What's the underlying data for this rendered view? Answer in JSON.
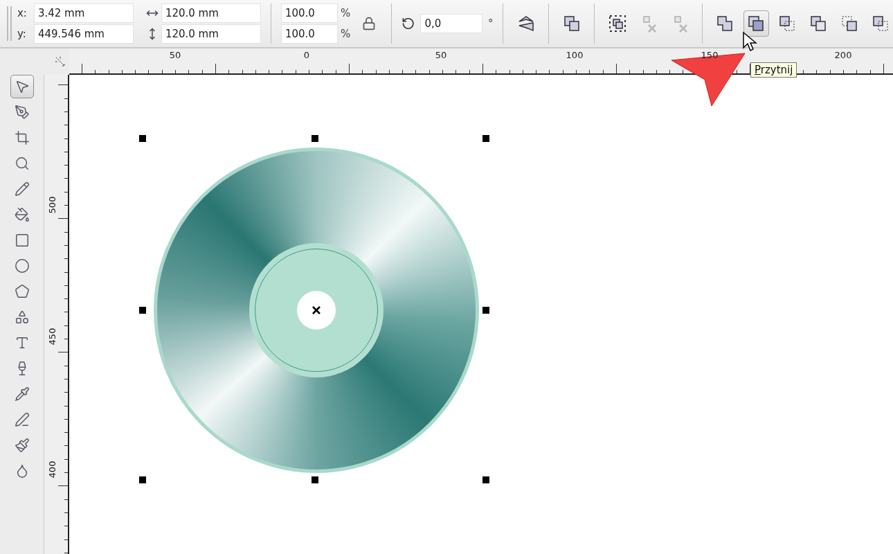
{
  "property_bar": {
    "position": [
      {
        "label": "x:",
        "value": "3.42 mm"
      },
      {
        "label": "y:",
        "value": "449.546 mm"
      }
    ],
    "size": [
      {
        "value": "120.0 mm"
      },
      {
        "value": "120.0 mm"
      }
    ],
    "scale": [
      {
        "value": "100.0",
        "unit": "%"
      },
      {
        "value": "100.0",
        "unit": "%"
      }
    ],
    "lock_ratio": {
      "on": false
    },
    "rotation": {
      "value": "0,0",
      "unit": "°"
    },
    "buttons": [
      {
        "kind": "mirror",
        "disabled": false,
        "hovered": false
      },
      {
        "kind": "group",
        "disabled": false,
        "hovered": false
      },
      {
        "kind": "combine",
        "disabled": false,
        "hovered": false
      },
      {
        "kind": "ungroup",
        "disabled": true,
        "hovered": false
      },
      {
        "kind": "ungroup",
        "disabled": true,
        "hovered": false
      },
      {
        "kind": "weld",
        "disabled": false,
        "hovered": false
      },
      {
        "kind": "trim",
        "disabled": false,
        "hovered": true
      },
      {
        "kind": "intersect",
        "disabled": false,
        "hovered": false
      },
      {
        "kind": "simplify",
        "disabled": false,
        "hovered": false
      },
      {
        "kind": "front",
        "disabled": false,
        "hovered": false
      },
      {
        "kind": "back",
        "disabled": false,
        "hovered": false
      }
    ]
  },
  "tooltip": "Przytnij",
  "ruler_h": [
    "50",
    "0",
    "50",
    "100",
    "150",
    "200"
  ],
  "ruler_v": [
    "500",
    "450",
    "400"
  ],
  "tools": [
    {
      "selected": true
    },
    {
      "selected": false
    },
    {
      "selected": false
    },
    {
      "selected": false
    },
    {
      "selected": false
    },
    {
      "selected": false
    },
    {
      "selected": false
    },
    {
      "selected": false
    },
    {
      "selected": false
    },
    {
      "selected": false
    },
    {
      "selected": false
    },
    {
      "selected": false
    },
    {
      "selected": false
    },
    {
      "selected": false
    },
    {
      "selected": false
    },
    {
      "selected": false
    }
  ]
}
